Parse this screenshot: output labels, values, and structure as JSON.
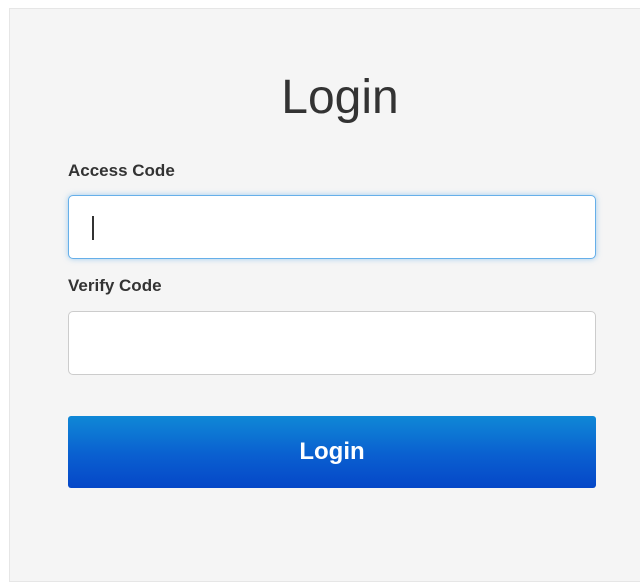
{
  "form": {
    "title": "Login",
    "access_code": {
      "label": "Access Code",
      "value": ""
    },
    "verify_code": {
      "label": "Verify Code",
      "value": ""
    },
    "submit_label": "Login"
  },
  "colors": {
    "panel_background": "#f5f5f5",
    "button_gradient_top": "#0f88d6",
    "button_gradient_bottom": "#0547c8",
    "focus_border": "#66afe9"
  }
}
